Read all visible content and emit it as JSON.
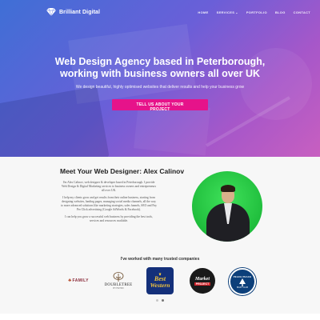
{
  "header": {
    "brand": "Brilliant Digital",
    "nav": [
      {
        "label": "HOME"
      },
      {
        "label": "SERVICES",
        "has_dropdown": true
      },
      {
        "label": "PORTFOLIO"
      },
      {
        "label": "BLOG"
      },
      {
        "label": "CONTACT"
      }
    ]
  },
  "hero": {
    "title_line1": "Web Design Agency based in Peterborough,",
    "title_line2": "working with business owners all over UK",
    "subtitle": "We design beautiful, highly optimised websites that deliver results and help your business grow",
    "cta": "TELL US ABOUT YOUR PROJECT"
  },
  "about": {
    "title": "Meet Your Web Designer: Alex Calinov",
    "paragraphs": [
      "I'm Alex Calinov, web designer & developer based in Peterborough. I provide Web Design & Digital Marketing services to business owners and entrepreneurs all over UK.",
      "I help my clients grow and get results from their online business, starting from designing websites, landing pages, managing social media channels, all the way to more advanced solutions like marketing strategies, sales funnels, SEO and Pay Per Click advertising (Google AdWords & Facebook).",
      "I can help you grow a successful web business by providing the best tools, services and resources available."
    ]
  },
  "trusted": {
    "heading": "I've worked with many trusted companies",
    "logos": {
      "family": "FAMILY",
      "doubletree": "DOUBLETREE",
      "doubletree_sub": "BY HILTON",
      "bw_best": "Best",
      "bw_western": "Western",
      "market": "Market",
      "market_sub": "PROJECT",
      "ap_ring": "PEACH PEACH",
      "ap_bottom": "BOAT CLUB"
    }
  },
  "slider": {
    "dots": 2,
    "active": 1
  },
  "colors": {
    "accent": "#e6138a",
    "hero_start": "#3f6fd6",
    "hero_end": "#c85fc0",
    "photo_bg": "#1fbd3c"
  }
}
